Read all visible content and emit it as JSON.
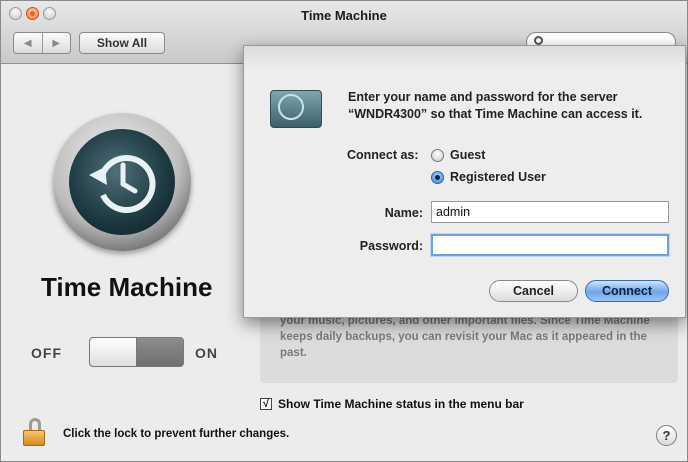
{
  "window": {
    "title": "Time Machine",
    "nav_back": "◀",
    "nav_forward": "▶",
    "show_all_label": "Show All",
    "search_placeholder": ""
  },
  "pane": {
    "heading": "Time Machine",
    "toggle_off_label": "OFF",
    "toggle_on_label": "ON",
    "toggle_state": "off",
    "info_text": "your music, pictures, and other important files. Since Time Machine keeps daily backups, you can revisit your Mac as it appeared in the past.",
    "status_checkbox_mark": "√",
    "status_checkbox_checked": true,
    "status_checkbox_label": "Show Time Machine status in the menu bar",
    "lock_text": "Click the lock to prevent further changes.",
    "help_label": "?"
  },
  "dialog": {
    "prompt": "Enter your name and password for the server “WNDR4300” so that Time Machine can access it.",
    "connect_as_label": "Connect as:",
    "options": [
      {
        "label": "Guest",
        "selected": false
      },
      {
        "label": "Registered User",
        "selected": true
      }
    ],
    "name_label": "Name:",
    "name_value": "admin",
    "password_label": "Password:",
    "password_value": "",
    "cancel_label": "Cancel",
    "connect_label": "Connect"
  },
  "colors": {
    "accent": "#3f86d8",
    "window_bg": "#ececec"
  }
}
